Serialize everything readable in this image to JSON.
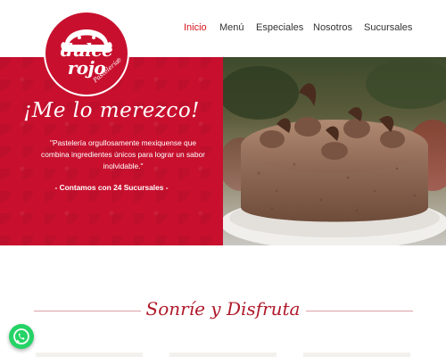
{
  "brand": {
    "line1": "dulce",
    "line2": "rojo",
    "tagline": "Pastelería",
    "registered": "®",
    "primary_color": "#c8102e",
    "accent_color": "#d7141a"
  },
  "nav": {
    "items": [
      {
        "label": "Inicio",
        "active": true
      },
      {
        "label": "Menú",
        "active": false
      },
      {
        "label": "Especiales",
        "active": false
      },
      {
        "label": "Nosotros",
        "active": false
      },
      {
        "label": "Sucursales",
        "active": false
      }
    ]
  },
  "hero": {
    "title": "¡Me lo merezco!",
    "description": "\"Pastelería orgullosamente mexiquense que combina ingredientes únicos para lograr un sabor inolvidable.\"",
    "cta": "- Contamos con 24 Sucursales -",
    "image_icon": "chocolate-cake-image"
  },
  "section": {
    "title": "Sonríe y Disfruta"
  },
  "floating": {
    "whatsapp_icon": "whatsapp-icon",
    "whatsapp_color": "#25d366"
  }
}
